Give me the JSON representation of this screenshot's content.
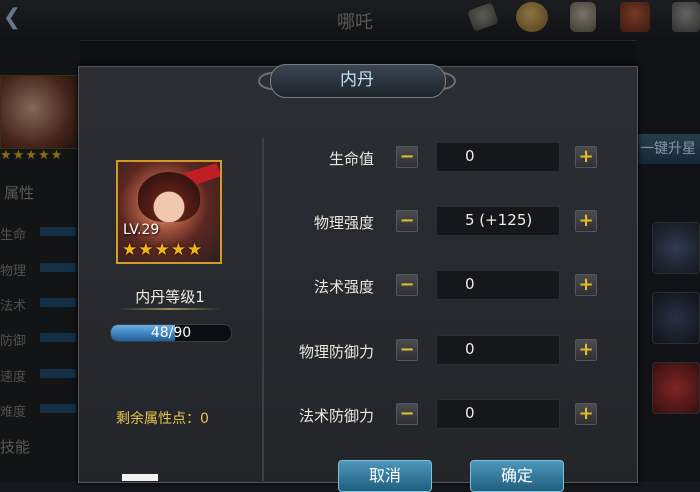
{
  "background": {
    "screen_title": "哪吒",
    "back_icon": "back-arrow-icon",
    "top_icons": [
      "scroll-icon",
      "coin-icon",
      "statue-icon",
      "chest-icon",
      "item-icon"
    ],
    "left_stars": "★★★★★",
    "section_attr": "属性",
    "stats": [
      "生命",
      "物理",
      "法术",
      "防御",
      "速度",
      "难度"
    ],
    "section_skill": "技能",
    "one_key_button": "一键升星"
  },
  "dialog": {
    "title": "内丹",
    "hero": {
      "level_label": "LV.29",
      "stars": "★★★★★",
      "neidan_level": "内丹等级1",
      "exp_text": "48/90",
      "exp_fraction": 0.533
    },
    "remaining_points": "剩余属性点：0",
    "attributes": [
      {
        "label": "生命值",
        "value": "0"
      },
      {
        "label": "物理强度",
        "value": "5 (+125)"
      },
      {
        "label": "法术强度",
        "value": "0"
      },
      {
        "label": "物理防御力",
        "value": "0"
      },
      {
        "label": "法术防御力",
        "value": "0"
      }
    ],
    "minus_symbol": "−",
    "plus_symbol": "+",
    "cancel_label": "取消",
    "confirm_label": "确定"
  },
  "colors": {
    "accent_gold": "#e8b828",
    "title_blue": "#bfe4f6",
    "button_blue": "#1f5f7e",
    "exp_blue": "#1d5f9c"
  }
}
